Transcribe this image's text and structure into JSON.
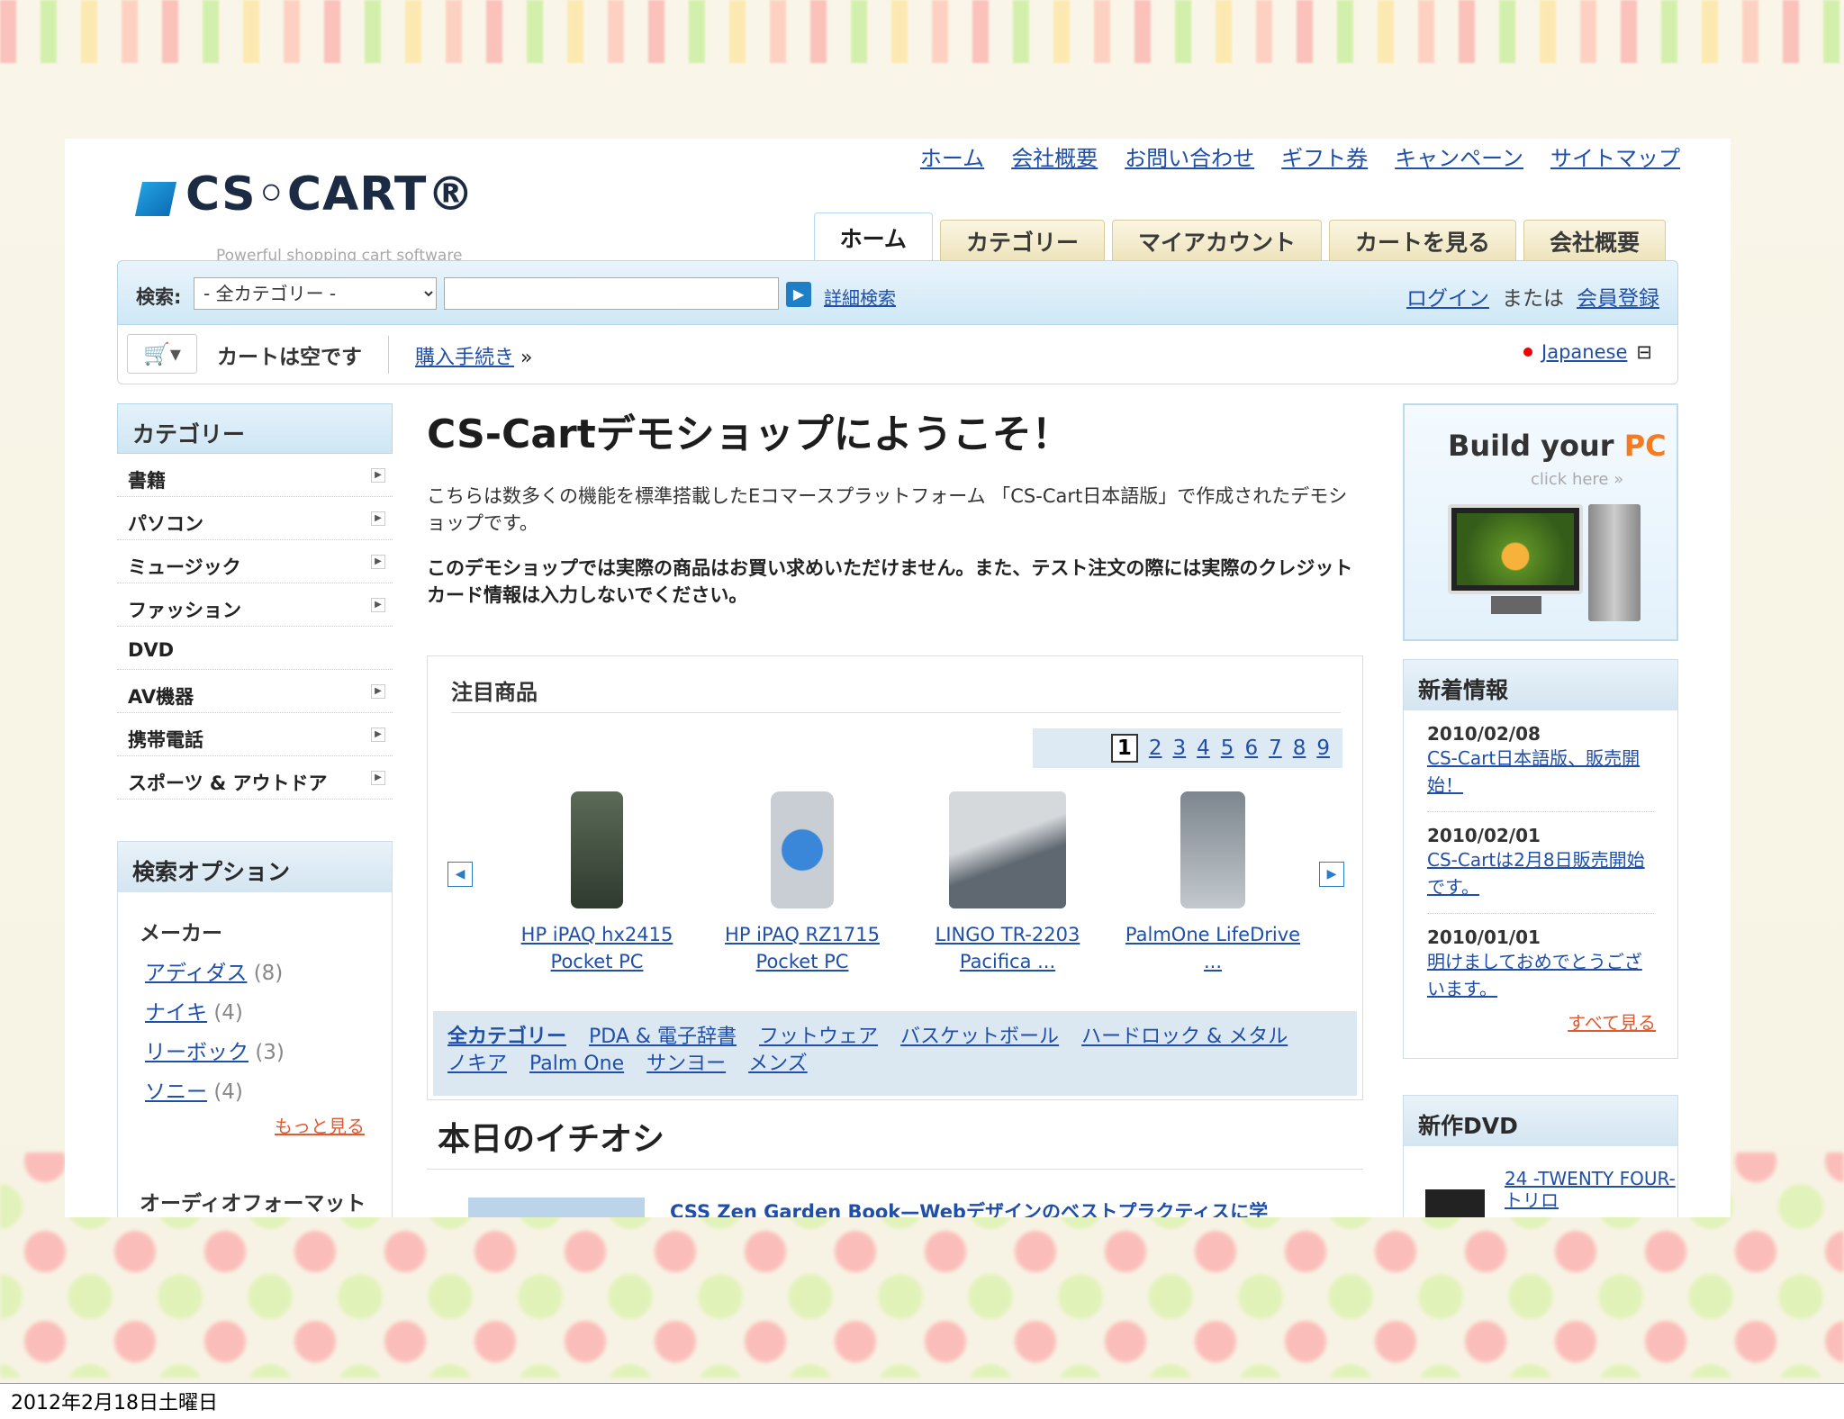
{
  "footer_date": "2012年2月18日土曜日",
  "logo": {
    "name": "CS◦CART®",
    "tagline": "Powerful shopping cart software"
  },
  "top_links": [
    "ホーム",
    "会社概要",
    "お問い合わせ",
    "ギフト券",
    "キャンペーン",
    "サイトマップ"
  ],
  "tabs": [
    "ホーム",
    "カテゴリー",
    "マイアカウント",
    "カートを見る",
    "会社概要"
  ],
  "search": {
    "label": "検索:",
    "category": "- 全カテゴリー -",
    "query": "",
    "advanced": "詳細検索",
    "login": "ログイン",
    "or": "または",
    "register": "会員登録"
  },
  "cart": {
    "icon": "cart-icon",
    "empty": "カートは空です",
    "checkout": "購入手続き",
    "language": "Japanese"
  },
  "categories": {
    "title": "カテゴリー",
    "items": [
      "書籍",
      "パソコン",
      "ミュージック",
      "ファッション",
      "DVD",
      "AV機器",
      "携帯電話",
      "スポーツ & アウトドア"
    ]
  },
  "search_options": {
    "title": "検索オプション",
    "maker_label": "メーカー",
    "brands": [
      {
        "name": "アディダス",
        "count": "(8)"
      },
      {
        "name": "ナイキ",
        "count": "(4)"
      },
      {
        "name": "リーボック",
        "count": "(3)"
      },
      {
        "name": "ソニー",
        "count": "(4)"
      }
    ],
    "more": "もっと見る",
    "audio_format": "オーディオフォーマット"
  },
  "main": {
    "title": "CS-Cartデモショップにようこそ！",
    "intro": "こちらは数多くの機能を標準搭載したEコマースプラットフォーム 「CS-Cart日本語版」で作成されたデモショップです。",
    "notice": "このデモショップでは実際の商品はお買い求めいただけません。また、テスト注文の際には実際のクレジットカード情報は入力しないでください。"
  },
  "featured": {
    "title": "注目商品",
    "pages": [
      "1",
      "2",
      "3",
      "4",
      "5",
      "6",
      "7",
      "8",
      "9"
    ],
    "products": [
      {
        "name": "HP iPAQ hx2415 Pocket PC"
      },
      {
        "name": "HP iPAQ RZ1715 Pocket PC"
      },
      {
        "name": "LINGO TR-2203 Pacifica ..."
      },
      {
        "name": "PalmOne LifeDrive ..."
      }
    ],
    "category_links": [
      "全カテゴリー",
      "PDA & 電子辞書",
      "フットウェア",
      "バスケットボール",
      "ハードロック & メタル",
      "ノキア",
      "Palm One",
      "サンヨー",
      "メンズ"
    ]
  },
  "today": {
    "title": "本日のイチオシ",
    "item": "CSS Zen Garden Book—Webデザインのベストプラクティスに学"
  },
  "build_pc": {
    "title_a": "Build your ",
    "title_b": "PC",
    "click": "click here »"
  },
  "news": {
    "title": "新着情報",
    "entries": [
      {
        "date": "2010/02/08",
        "text": "CS-Cart日本語版、販売開始！"
      },
      {
        "date": "2010/02/01",
        "text": "CS-Cartは2月8日販売開始です。"
      },
      {
        "date": "2010/01/01",
        "text": "明けましておめでとうございます。"
      }
    ],
    "all": "すべて見る"
  },
  "dvd": {
    "title": "新作DVD",
    "item": "24 -TWENTY FOUR- トリロ"
  }
}
